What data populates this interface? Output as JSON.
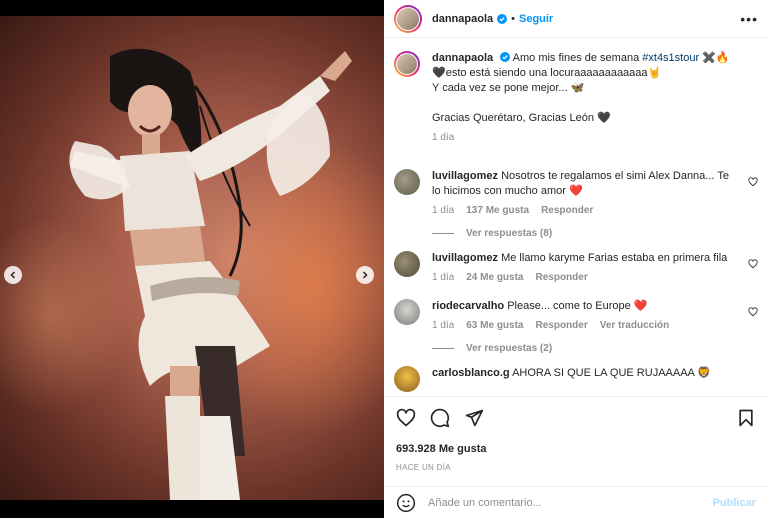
{
  "header": {
    "username": "dannapaola",
    "separator": "•",
    "follow_label": "Seguir",
    "more_label": "•••"
  },
  "caption": {
    "username": "dannapaola",
    "text_line1": "Amo mis fines de semana ",
    "hashtag": "#xt4s1stour",
    "emoji1": " ✖️🔥",
    "line2": "🖤esto está siendo una locuraaaaaaaaaaaa🤘",
    "line3": "Y cada vez se pone mejor... 🦋",
    "line4": "Gracias Querétaro, Gracias León 🖤",
    "time": "1 día"
  },
  "comments": [
    {
      "username": "luvillagomez",
      "text": "Nosotros te regalamos el simi Alex Danna... Te lo hicimos con mucho amor ❤️",
      "time": "1 día",
      "likes": "137 Me gusta",
      "reply": "Responder",
      "replies": "Ver respuestas (8)"
    },
    {
      "username": "luvillagomez",
      "text": "Me llamo karyme Farias estaba en primera fila",
      "time": "1 día",
      "likes": "24 Me gusta",
      "reply": "Responder"
    },
    {
      "username": "riodecarvalho",
      "text": "Please... come to Europe ❤️",
      "time": "1 día",
      "likes": "63 Me gusta",
      "reply": "Responder",
      "translate": "Ver traducción",
      "replies": "Ver respuestas (2)"
    },
    {
      "username": "carlosblanco.g",
      "text": "AHORA SI QUE LA QUE RUJAAAAA 🦁"
    }
  ],
  "footer": {
    "likes": "693.928 Me gusta",
    "time": "HACE UN DÍA",
    "comment_placeholder": "Añade un comentario...",
    "publish_label": "Publicar"
  },
  "carousel": {
    "slide_count": 7,
    "active_index": 3
  },
  "colors": {
    "accent": "#0095f6",
    "publish_disabled": "#b2dffc",
    "hashtag": "#00376b",
    "heart": "#ed4956"
  }
}
